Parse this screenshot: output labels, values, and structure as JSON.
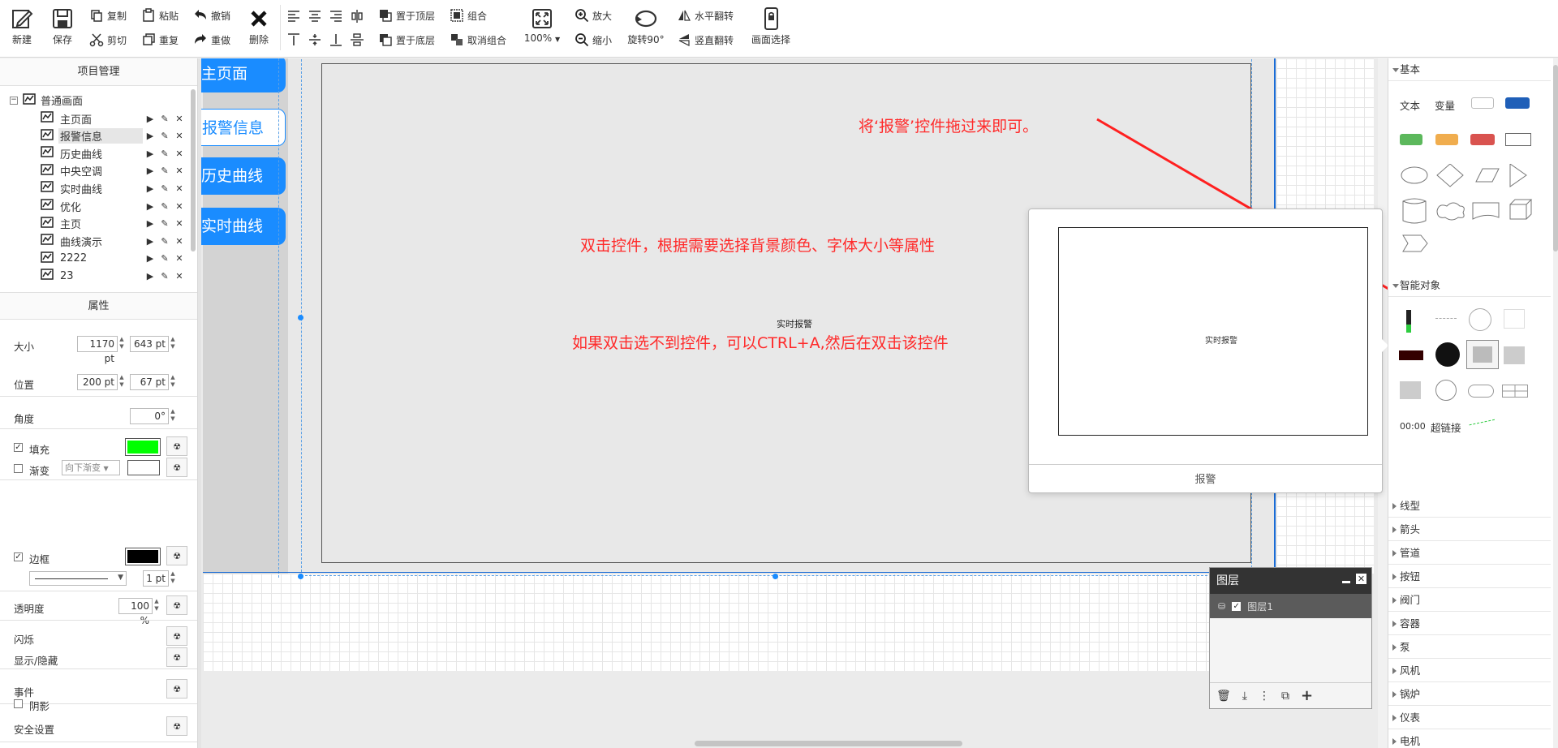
{
  "toolbar": {
    "new": "新建",
    "save": "保存",
    "copy": "复制",
    "paste": "粘贴",
    "undo": "撤销",
    "cut": "剪切",
    "duplicate": "重复",
    "redo": "重做",
    "delete": "删除",
    "to_top": "置于顶层",
    "to_bottom": "置于底层",
    "group": "组合",
    "ungroup": "取消组合",
    "zoom": "100%",
    "zoom_in": "放大",
    "zoom_out": "缩小",
    "rotate": "旋转90°",
    "flip_h": "水平翻转",
    "flip_v": "竖直翻转",
    "screen_select": "画面选择"
  },
  "left_panel": {
    "title": "项目管理",
    "tree_root": "普通画面",
    "tree_items": [
      {
        "label": "主页面"
      },
      {
        "label": "报警信息"
      },
      {
        "label": "历史曲线"
      },
      {
        "label": "中央空调"
      },
      {
        "label": "实时曲线"
      },
      {
        "label": "优化"
      },
      {
        "label": "主页"
      },
      {
        "label": "曲线演示"
      },
      {
        "label": "2222"
      },
      {
        "label": "23"
      }
    ],
    "selected_index": 1,
    "props_title": "属性",
    "size_label": "大小",
    "width": "1170 pt",
    "height": "643 pt",
    "pos_label": "位置",
    "x": "200 pt",
    "y": "67 pt",
    "angle_label": "角度",
    "angle": "0°",
    "fill_label": "填充",
    "fill_checked": true,
    "fill_color": "#00ff00",
    "gradient_label": "渐变",
    "gradient_checked": false,
    "gradient_dir": "向下渐变",
    "border_label": "边框",
    "border_checked": true,
    "border_color": "#000000",
    "border_width": "1 pt",
    "opacity_label": "透明度",
    "opacity": "100 %",
    "blink_label": "闪烁",
    "visibility_label": "显示/隐藏",
    "event_label": "事件",
    "security_label": "安全设置",
    "shadow_label": "阴影"
  },
  "canvas": {
    "nav_buttons": [
      {
        "label": "主页面"
      },
      {
        "label": "报警信息"
      },
      {
        "label": "历史曲线"
      },
      {
        "label": "实时曲线"
      }
    ],
    "widget_label": "实时报警",
    "annotation_1": "将‘报警’控件拖过来即可。",
    "annotation_2": "双击控件，根据需要选择背景颜色、字体大小等属性",
    "annotation_3": "如果双击选不到控件，可以CTRL+A,然后在双击该控件"
  },
  "preview": {
    "inner_label": "实时报警",
    "footer": "报警"
  },
  "layers": {
    "title": "图层",
    "rows": [
      {
        "label": "图层1"
      }
    ]
  },
  "right_panel": {
    "basic": "基本",
    "text": "文本",
    "variable": "变量",
    "smart": "智能对象",
    "clock": "00:00",
    "hyperlink": "超链接",
    "categories": [
      "线型",
      "箭头",
      "管道",
      "按钮",
      "阀门",
      "容器",
      "泵",
      "风机",
      "锅炉",
      "仪表",
      "电机"
    ]
  }
}
